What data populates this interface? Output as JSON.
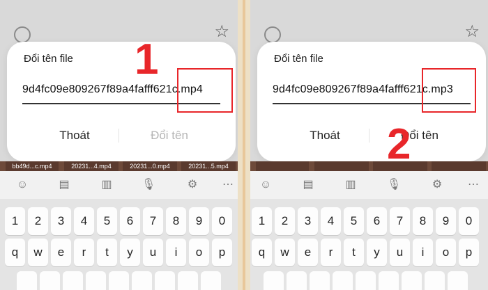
{
  "panels": [
    {
      "id": "left",
      "dialog": {
        "title": "Đổi tên file",
        "filename": "9d4fc09e809267f89a4fafff621c.mp4",
        "exit_label": "Thoát",
        "rename_label": "Đổi tên",
        "rename_enabled": false
      },
      "step_number": "1"
    },
    {
      "id": "right",
      "dialog": {
        "title": "Đổi tên file",
        "filename": "9d4fc09e809267f89a4fafff621c.mp3",
        "exit_label": "Thoát",
        "rename_label": "Đổi tên",
        "rename_enabled": true
      },
      "step_number": "2"
    }
  ],
  "thumbnails": [
    "bb49d...c.mp4",
    "20231...4.mp4",
    "20231...0.mp4",
    "20231...5.mp4"
  ],
  "keyboard_toolbar_icons": [
    "emoji-icon",
    "clipboard-icon",
    "document-icon",
    "microphone-icon",
    "settings-icon",
    "more-icon"
  ],
  "keyboard": {
    "row1": [
      "1",
      "2",
      "3",
      "4",
      "5",
      "6",
      "7",
      "8",
      "9",
      "0"
    ],
    "row2": [
      "q",
      "w",
      "e",
      "r",
      "t",
      "y",
      "u",
      "i",
      "o",
      "p"
    ]
  },
  "colors": {
    "highlight": "#e8262a",
    "rename_disabled": "#b5b5b5",
    "rename_enabled": "#222222"
  }
}
